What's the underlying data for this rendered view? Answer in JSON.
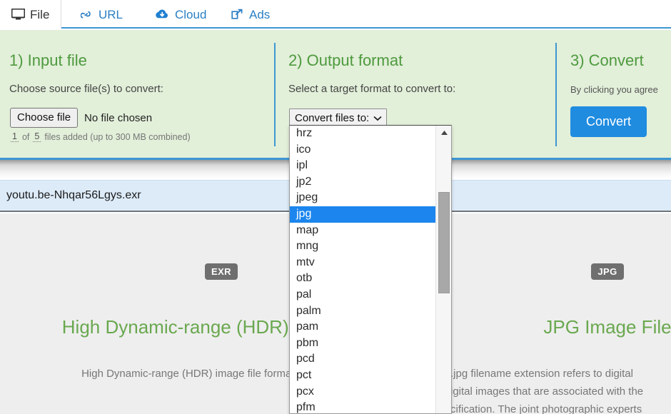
{
  "tabs": [
    {
      "label": "File",
      "icon": "monitor-icon",
      "active": true
    },
    {
      "label": "URL",
      "icon": "link-icon",
      "active": false
    },
    {
      "label": "Cloud",
      "icon": "cloud-download-icon",
      "active": false
    },
    {
      "label": "Ads",
      "icon": "external-link-icon",
      "active": false
    }
  ],
  "steps": {
    "input": {
      "title": "1) Input file",
      "subtitle": "Choose source file(s) to convert:",
      "button_label": "Choose file",
      "file_status": "No file chosen",
      "count_current": "1",
      "count_word": "of",
      "count_max": "5",
      "count_suffix": "files added (up to 300 MB combined)"
    },
    "output": {
      "title": "2) Output format",
      "subtitle": "Select a target format to convert to:",
      "select_label": "Convert files to:",
      "select_caret": "chevron-down-icon"
    },
    "convert": {
      "title": "3) Convert",
      "agree_text": "By clicking you agree",
      "button_label": "Convert"
    }
  },
  "dropdown": {
    "selected": "jpg",
    "options": [
      "hrz",
      "ico",
      "ipl",
      "jp2",
      "jpeg",
      "jpg",
      "map",
      "mng",
      "mtv",
      "otb",
      "pal",
      "palm",
      "pam",
      "pbm",
      "pcd",
      "pct",
      "pcx",
      "pfm"
    ],
    "scroll_up_icon": "triangle-up-icon"
  },
  "file_row": {
    "filename": "youtu.be-Nhqar56Lgys.exr"
  },
  "info": {
    "source": {
      "badge": "EXR",
      "title": "High Dynamic-range (HDR) Image File",
      "body": "High Dynamic-range (HDR) image file format developed by"
    },
    "target": {
      "badge": "JPG",
      "title": "JPG Image File",
      "body": ".jpg filename extension refers to digital\nigital images that are associated with the\ncification. The joint photographic experts"
    }
  },
  "colors": {
    "accent_blue": "#3d97d3",
    "button_blue": "#1f8ce0",
    "panel_green": "#e2efd9",
    "title_green": "#4e9a3e",
    "selection_blue": "#1c86ee",
    "file_row_blue": "#ddebf9",
    "badge_gray": "#6f6f6f"
  }
}
